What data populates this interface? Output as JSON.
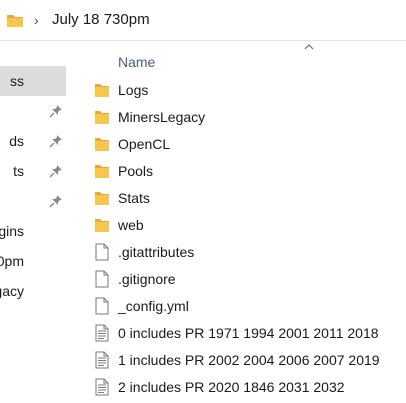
{
  "address_bar": {
    "path": "July 18 730pm",
    "chevron": "›"
  },
  "nav_pane": {
    "items": [
      {
        "label": "ss",
        "selected": true,
        "pinned": false
      },
      {
        "label": "",
        "selected": false,
        "pinned": true
      },
      {
        "label": "ds",
        "selected": false,
        "pinned": true
      },
      {
        "label": "ts",
        "selected": false,
        "pinned": true
      },
      {
        "label": "",
        "selected": false,
        "pinned": true
      },
      {
        "label": "gins",
        "selected": false,
        "pinned": false
      },
      {
        "label": "0pm",
        "selected": false,
        "pinned": false
      },
      {
        "label": "gacy",
        "selected": false,
        "pinned": false
      }
    ]
  },
  "header": {
    "name_label": "Name",
    "sort_icon": "chevron-up-icon"
  },
  "files": [
    {
      "name": "Logs",
      "type": "folder"
    },
    {
      "name": "MinersLegacy",
      "type": "folder"
    },
    {
      "name": "OpenCL",
      "type": "folder"
    },
    {
      "name": "Pools",
      "type": "folder"
    },
    {
      "name": "Stats",
      "type": "folder"
    },
    {
      "name": "web",
      "type": "folder"
    },
    {
      "name": ".gitattributes",
      "type": "file"
    },
    {
      "name": ".gitignore",
      "type": "file"
    },
    {
      "name": "_config.yml",
      "type": "file"
    },
    {
      "name": "0 includes PR 1971 1994 2001 2011 2018",
      "type": "text"
    },
    {
      "name": "1 includes PR 2002 2004 2006 2007 2019",
      "type": "text"
    },
    {
      "name": "2 includes PR 2020 1846 2031 2032",
      "type": "text"
    }
  ],
  "colors": {
    "folder": "#f7c64f",
    "folder_dark": "#e2a93b",
    "selected_bg": "#dcdcdc",
    "header_text": "#4c607a"
  }
}
